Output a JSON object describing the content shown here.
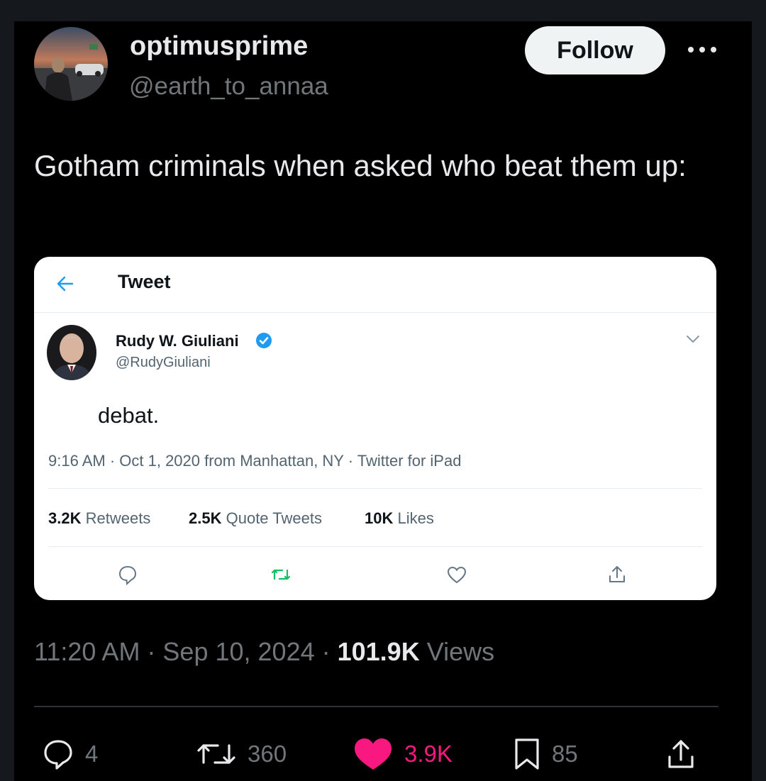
{
  "header": {
    "display_name": "optimusprime",
    "handle": "@earth_to_annaa",
    "follow_label": "Follow"
  },
  "post": {
    "text": "Gotham criminals when asked who beat them up:",
    "timestamp": "11:20 AM · Sep 10, 2024 · ",
    "views_count": "101.9K",
    "views_label": " Views"
  },
  "embedded": {
    "header_title": "Tweet",
    "author_name": "Rudy W. Giuliani",
    "author_handle": "@RudyGiuliani",
    "text": "debat.",
    "meta": "9:16 AM · Oct 1, 2020 from Manhattan, NY · Twitter for iPad",
    "stats": {
      "retweets_count": "3.2K",
      "retweets_label": "Retweets",
      "quotes_count": "2.5K",
      "quotes_label": "Quote Tweets",
      "likes_count": "10K",
      "likes_label": "Likes"
    }
  },
  "actions": {
    "replies": "4",
    "reposts": "360",
    "likes": "3.9K",
    "bookmarks": "85"
  },
  "colors": {
    "background": "#000000",
    "like_active": "#f91880",
    "verified": "#1d9bf0",
    "retweet_green": "#17bf63",
    "secondary_text": "#71767b"
  },
  "icons": [
    "more-icon",
    "back-arrow-icon",
    "verified-badge-icon",
    "chevron-down-icon",
    "reply-icon",
    "retweet-icon",
    "like-icon",
    "share-icon",
    "bookmark-icon"
  ]
}
